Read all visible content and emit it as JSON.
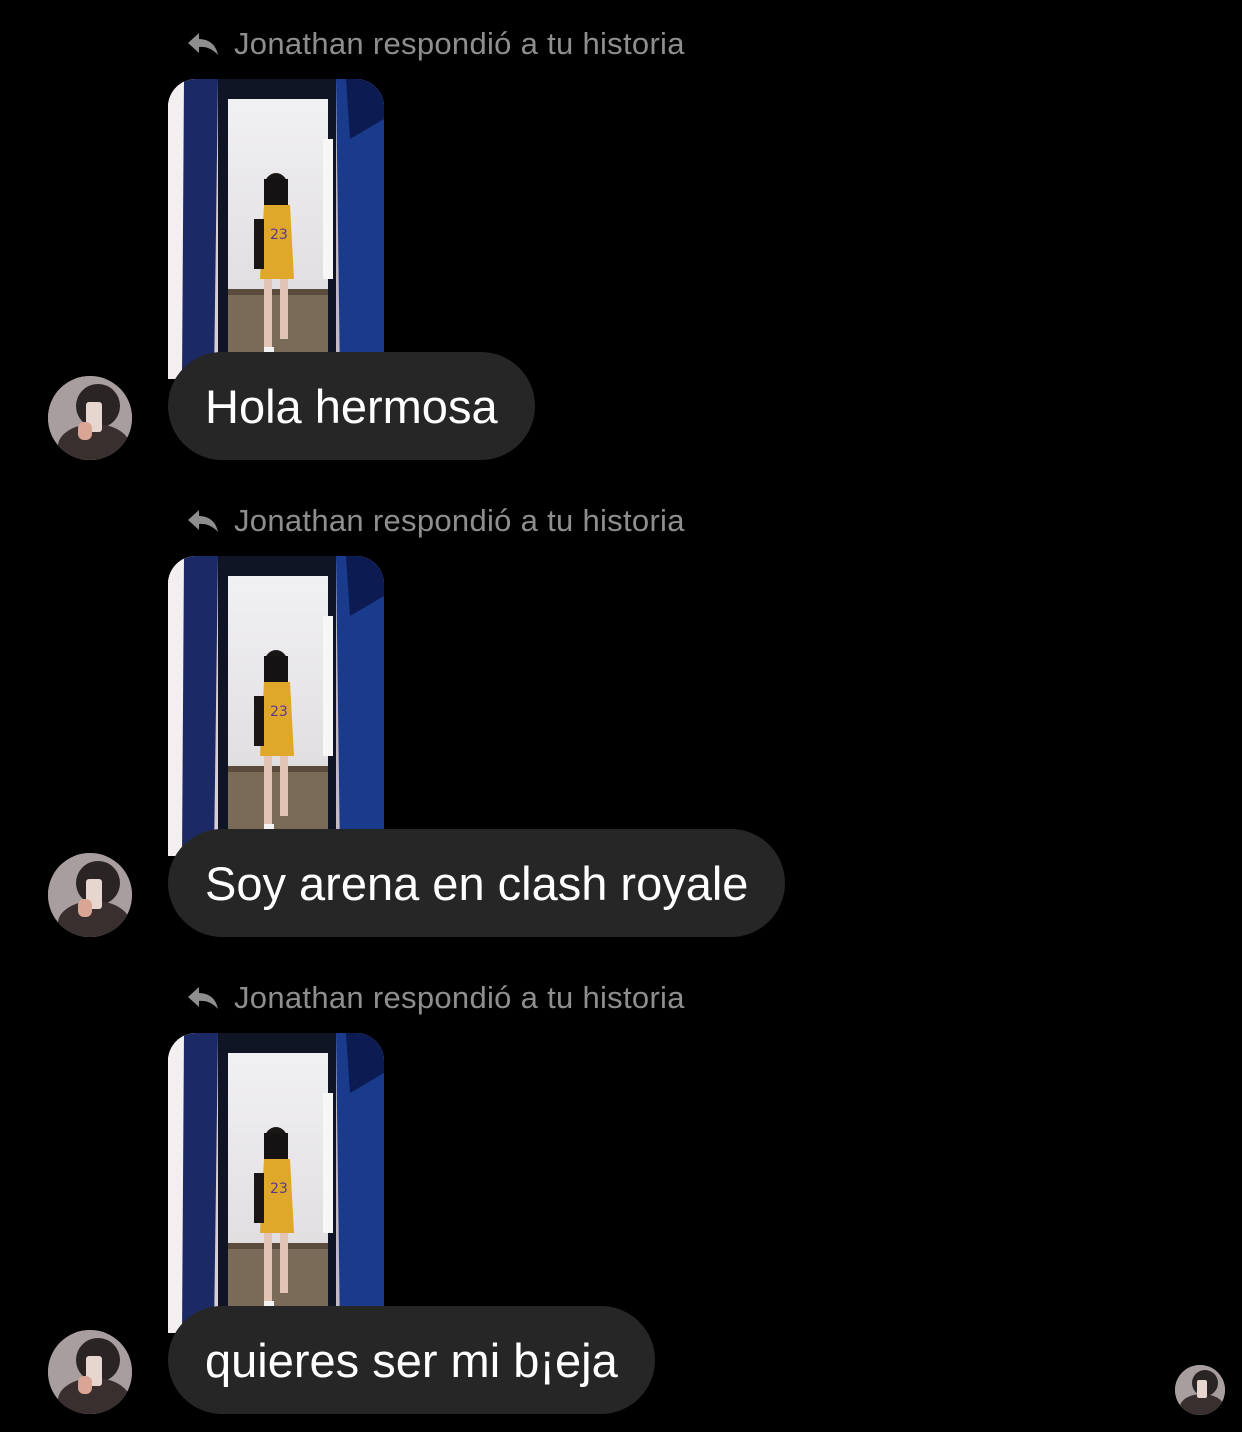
{
  "thread": {
    "messages": [
      {
        "reply_label": "Jonathan respondió a tu historia",
        "text": "Hola hermosa"
      },
      {
        "reply_label": "Jonathan respondió a tu historia",
        "text": "Soy arena en clash royale"
      },
      {
        "reply_label": "Jonathan respondió a tu historia",
        "text": "quieres ser mi b¡eja"
      }
    ]
  },
  "icons": {
    "reply": "reply-arrow-icon",
    "avatar": "user-avatar",
    "seen": "seen-avatar"
  },
  "colors": {
    "background": "#000000",
    "bubble": "#262626",
    "bubble_text": "#ffffff",
    "meta_text": "#8e8e8e"
  }
}
